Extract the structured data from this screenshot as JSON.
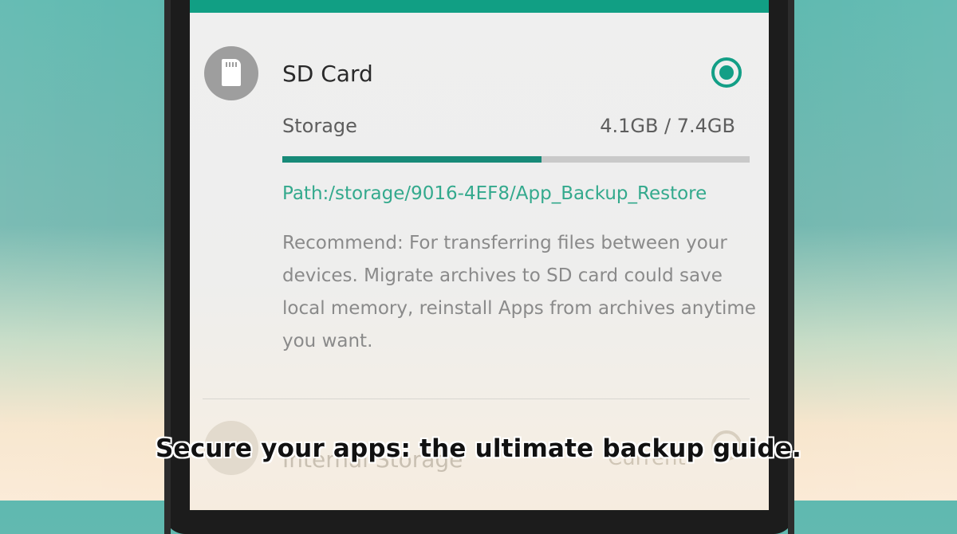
{
  "sd_card": {
    "title": "SD Card",
    "icon": "sd-card-icon",
    "selected": true,
    "storage_label": "Storage",
    "storage_value": "4.1GB / 7.4GB",
    "storage_used_fraction": 0.554,
    "path": "Path:/storage/9016-4EF8/App_Backup_Restore",
    "recommend": "Recommend: For transferring files between your devices. Migrate archives to SD card could save local memory, reinstall Apps from archives anytime you want."
  },
  "internal_storage": {
    "title": "Internal Storage",
    "status": "Current",
    "icon": "phone-storage-icon",
    "selected": false
  },
  "caption": "Secure your apps: the ultimate backup guide.",
  "colors": {
    "accent": "#119f84",
    "progress_fill": "#178a78",
    "path_text": "#33a98d"
  }
}
